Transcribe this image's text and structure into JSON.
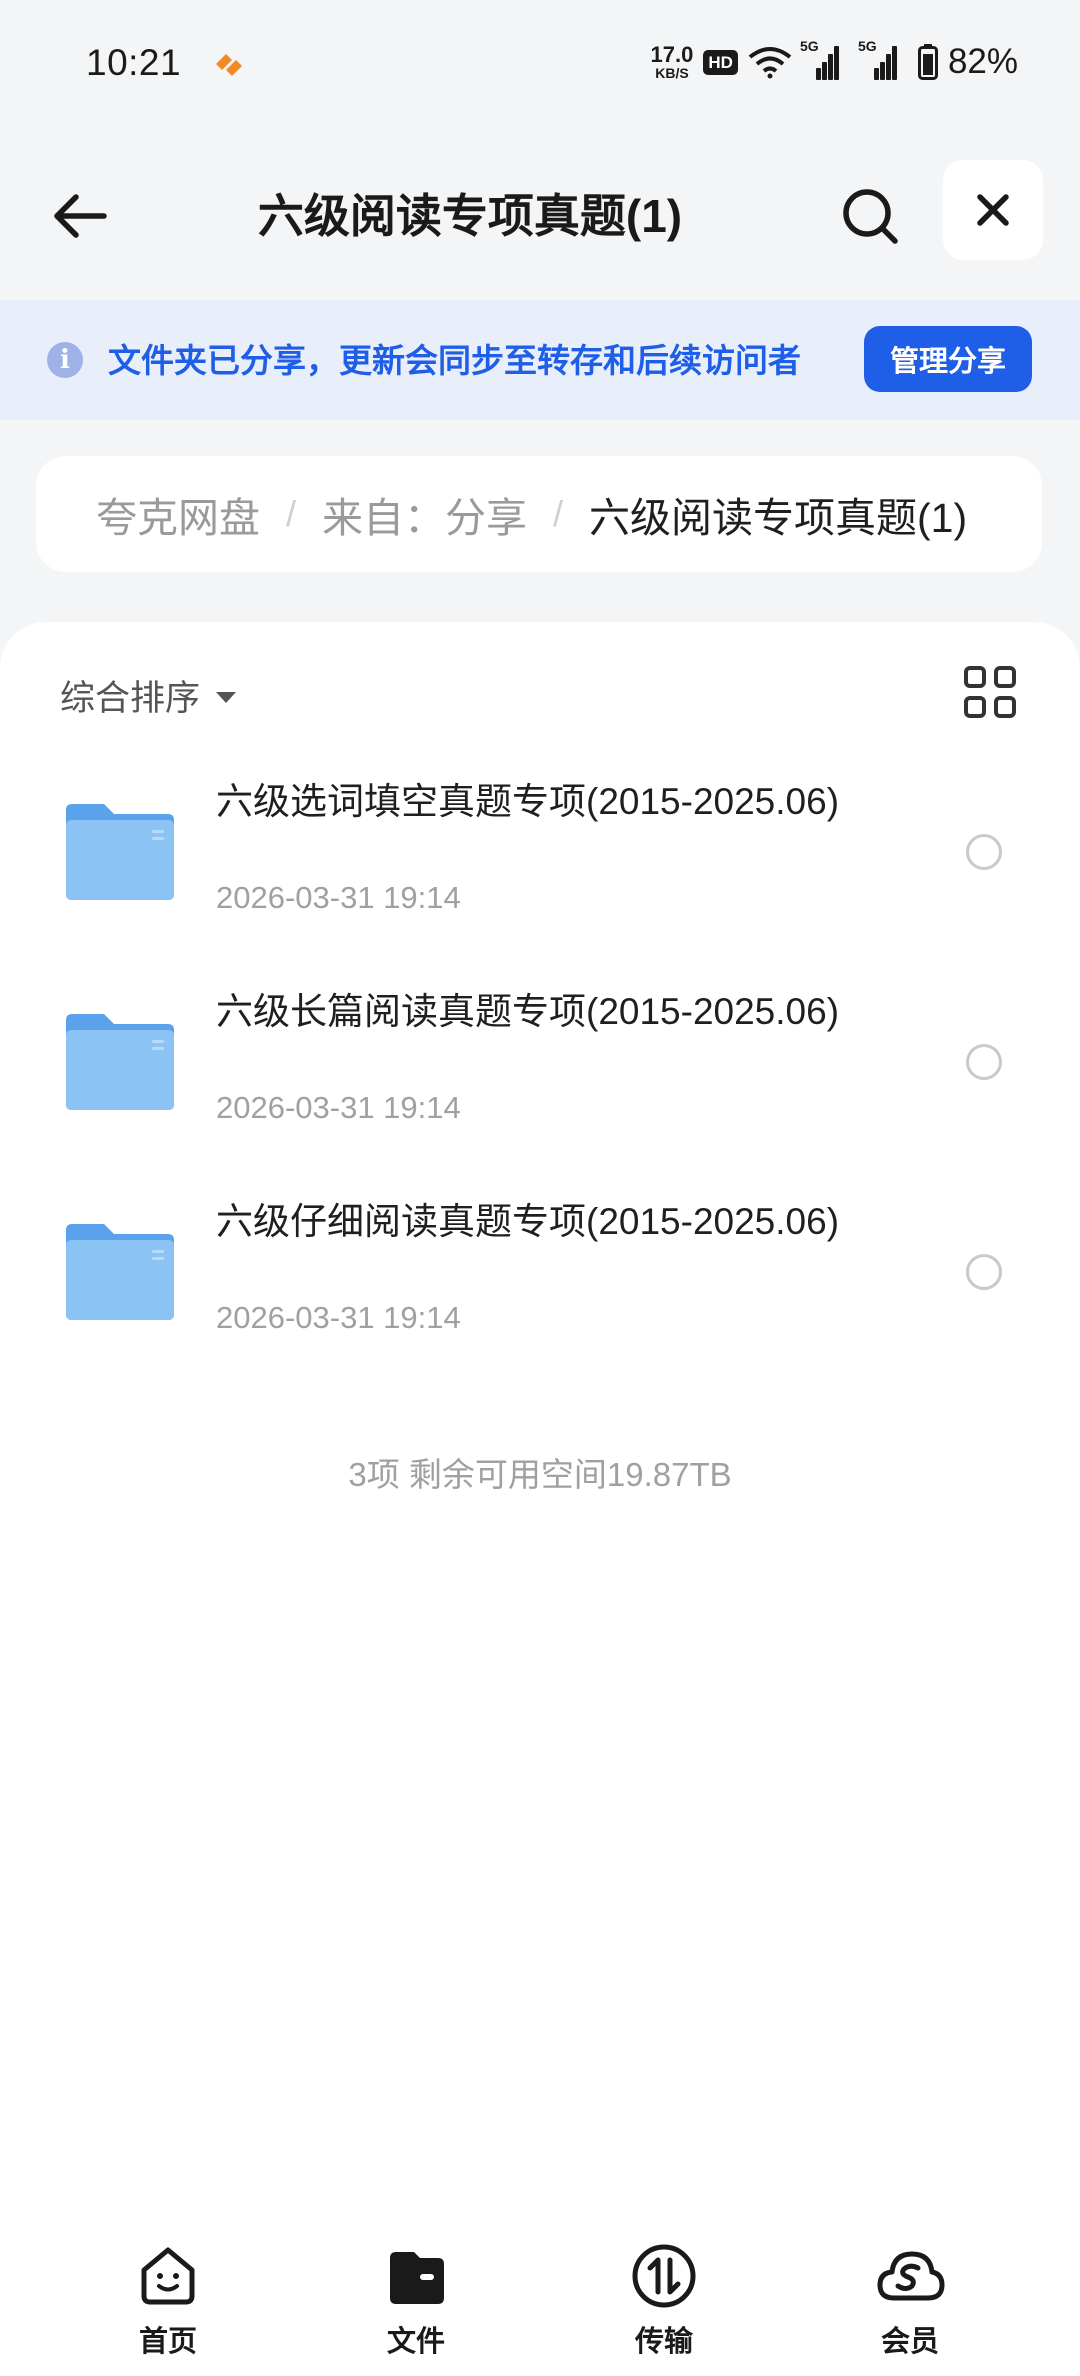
{
  "status_bar": {
    "time": "10:21",
    "net_speed_value": "17.0",
    "net_speed_unit": "KB/S",
    "hd_badge": "HD",
    "signal_1_tag": "5G",
    "signal_2_tag": "5G",
    "battery_percent": "82%",
    "app_icon": "quark-app-icon"
  },
  "header": {
    "title": "六级阅读专项真题(1)",
    "back_icon": "arrow-left-icon",
    "search_icon": "search-icon",
    "close_icon": "close-icon"
  },
  "share_banner": {
    "icon": "info-icon",
    "icon_glyph": "i",
    "text": "文件夹已分享，更新会同步至转存和后续访问者",
    "button_label": "管理分享"
  },
  "breadcrumb": {
    "items": [
      "夸克网盘",
      "来自：分享",
      "六级阅读专项真题(1)"
    ],
    "separator": "/"
  },
  "toolbar": {
    "sort_label": "综合排序",
    "sort_icon": "caret-down-icon",
    "view_toggle_icon": "grid-view-icon"
  },
  "files": [
    {
      "name": "六级选词填空真题专项(2015-2025.06)",
      "date": "2026-03-31 19:14",
      "icon": "folder-icon",
      "selected": false
    },
    {
      "name": "六级长篇阅读真题专项(2015-2025.06)",
      "date": "2026-03-31 19:14",
      "icon": "folder-icon",
      "selected": false
    },
    {
      "name": "六级仔细阅读真题专项(2015-2025.06)",
      "date": "2026-03-31 19:14",
      "icon": "folder-icon",
      "selected": false
    }
  ],
  "summary": "3项 剩余可用空间19.87TB",
  "bottom_nav": [
    {
      "label": "首页",
      "icon": "home-smile-icon"
    },
    {
      "label": "文件",
      "icon": "folder-wallet-icon",
      "active": true
    },
    {
      "label": "传输",
      "icon": "transfer-icon"
    },
    {
      "label": "会员",
      "icon": "cloud-member-icon"
    }
  ],
  "colors": {
    "accent": "#1f5ee6",
    "banner_bg": "#e9eefb",
    "page_bg": "#f4f5f7",
    "folder": "#7db8f2",
    "app_icon": "#f08a24"
  }
}
